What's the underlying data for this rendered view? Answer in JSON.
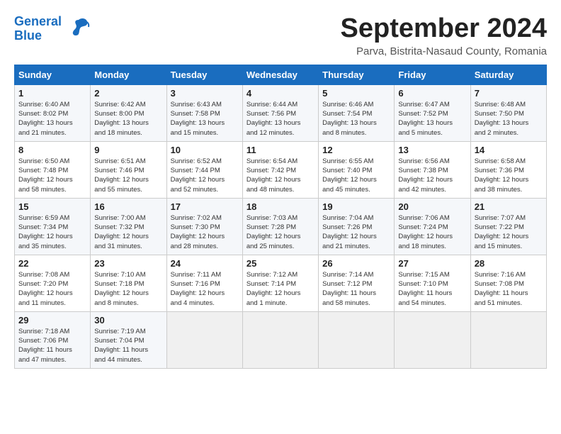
{
  "logo": {
    "line1": "General",
    "line2": "Blue"
  },
  "title": "September 2024",
  "location": "Parva, Bistrita-Nasaud County, Romania",
  "days_header": [
    "Sunday",
    "Monday",
    "Tuesday",
    "Wednesday",
    "Thursday",
    "Friday",
    "Saturday"
  ],
  "weeks": [
    [
      {
        "num": "1",
        "info": "Sunrise: 6:40 AM\nSunset: 8:02 PM\nDaylight: 13 hours\nand 21 minutes."
      },
      {
        "num": "2",
        "info": "Sunrise: 6:42 AM\nSunset: 8:00 PM\nDaylight: 13 hours\nand 18 minutes."
      },
      {
        "num": "3",
        "info": "Sunrise: 6:43 AM\nSunset: 7:58 PM\nDaylight: 13 hours\nand 15 minutes."
      },
      {
        "num": "4",
        "info": "Sunrise: 6:44 AM\nSunset: 7:56 PM\nDaylight: 13 hours\nand 12 minutes."
      },
      {
        "num": "5",
        "info": "Sunrise: 6:46 AM\nSunset: 7:54 PM\nDaylight: 13 hours\nand 8 minutes."
      },
      {
        "num": "6",
        "info": "Sunrise: 6:47 AM\nSunset: 7:52 PM\nDaylight: 13 hours\nand 5 minutes."
      },
      {
        "num": "7",
        "info": "Sunrise: 6:48 AM\nSunset: 7:50 PM\nDaylight: 13 hours\nand 2 minutes."
      }
    ],
    [
      {
        "num": "8",
        "info": "Sunrise: 6:50 AM\nSunset: 7:48 PM\nDaylight: 12 hours\nand 58 minutes."
      },
      {
        "num": "9",
        "info": "Sunrise: 6:51 AM\nSunset: 7:46 PM\nDaylight: 12 hours\nand 55 minutes."
      },
      {
        "num": "10",
        "info": "Sunrise: 6:52 AM\nSunset: 7:44 PM\nDaylight: 12 hours\nand 52 minutes."
      },
      {
        "num": "11",
        "info": "Sunrise: 6:54 AM\nSunset: 7:42 PM\nDaylight: 12 hours\nand 48 minutes."
      },
      {
        "num": "12",
        "info": "Sunrise: 6:55 AM\nSunset: 7:40 PM\nDaylight: 12 hours\nand 45 minutes."
      },
      {
        "num": "13",
        "info": "Sunrise: 6:56 AM\nSunset: 7:38 PM\nDaylight: 12 hours\nand 42 minutes."
      },
      {
        "num": "14",
        "info": "Sunrise: 6:58 AM\nSunset: 7:36 PM\nDaylight: 12 hours\nand 38 minutes."
      }
    ],
    [
      {
        "num": "15",
        "info": "Sunrise: 6:59 AM\nSunset: 7:34 PM\nDaylight: 12 hours\nand 35 minutes."
      },
      {
        "num": "16",
        "info": "Sunrise: 7:00 AM\nSunset: 7:32 PM\nDaylight: 12 hours\nand 31 minutes."
      },
      {
        "num": "17",
        "info": "Sunrise: 7:02 AM\nSunset: 7:30 PM\nDaylight: 12 hours\nand 28 minutes."
      },
      {
        "num": "18",
        "info": "Sunrise: 7:03 AM\nSunset: 7:28 PM\nDaylight: 12 hours\nand 25 minutes."
      },
      {
        "num": "19",
        "info": "Sunrise: 7:04 AM\nSunset: 7:26 PM\nDaylight: 12 hours\nand 21 minutes."
      },
      {
        "num": "20",
        "info": "Sunrise: 7:06 AM\nSunset: 7:24 PM\nDaylight: 12 hours\nand 18 minutes."
      },
      {
        "num": "21",
        "info": "Sunrise: 7:07 AM\nSunset: 7:22 PM\nDaylight: 12 hours\nand 15 minutes."
      }
    ],
    [
      {
        "num": "22",
        "info": "Sunrise: 7:08 AM\nSunset: 7:20 PM\nDaylight: 12 hours\nand 11 minutes."
      },
      {
        "num": "23",
        "info": "Sunrise: 7:10 AM\nSunset: 7:18 PM\nDaylight: 12 hours\nand 8 minutes."
      },
      {
        "num": "24",
        "info": "Sunrise: 7:11 AM\nSunset: 7:16 PM\nDaylight: 12 hours\nand 4 minutes."
      },
      {
        "num": "25",
        "info": "Sunrise: 7:12 AM\nSunset: 7:14 PM\nDaylight: 12 hours\nand 1 minute."
      },
      {
        "num": "26",
        "info": "Sunrise: 7:14 AM\nSunset: 7:12 PM\nDaylight: 11 hours\nand 58 minutes."
      },
      {
        "num": "27",
        "info": "Sunrise: 7:15 AM\nSunset: 7:10 PM\nDaylight: 11 hours\nand 54 minutes."
      },
      {
        "num": "28",
        "info": "Sunrise: 7:16 AM\nSunset: 7:08 PM\nDaylight: 11 hours\nand 51 minutes."
      }
    ],
    [
      {
        "num": "29",
        "info": "Sunrise: 7:18 AM\nSunset: 7:06 PM\nDaylight: 11 hours\nand 47 minutes."
      },
      {
        "num": "30",
        "info": "Sunrise: 7:19 AM\nSunset: 7:04 PM\nDaylight: 11 hours\nand 44 minutes."
      },
      {
        "num": "",
        "info": ""
      },
      {
        "num": "",
        "info": ""
      },
      {
        "num": "",
        "info": ""
      },
      {
        "num": "",
        "info": ""
      },
      {
        "num": "",
        "info": ""
      }
    ]
  ]
}
